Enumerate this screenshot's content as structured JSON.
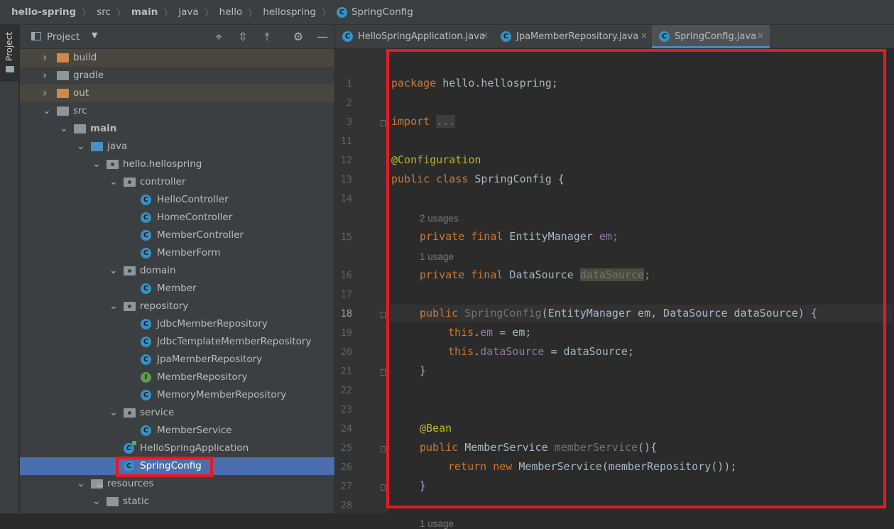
{
  "breadcrumb": [
    "hello-spring",
    "src",
    "main",
    "java",
    "hello",
    "hellospring",
    "SpringConfig"
  ],
  "tool_stripe": {
    "label": "Project"
  },
  "project_panel": {
    "title": "Project",
    "header_icons": [
      "locate-icon",
      "expand-all-icon",
      "collapse-all-icon",
      "gear-icon",
      "minimize-icon"
    ],
    "tree": [
      {
        "label": "build",
        "depth": 1,
        "icon": "folder-orange",
        "arrow": "right",
        "highlight": true
      },
      {
        "label": "gradle",
        "depth": 1,
        "icon": "folder",
        "arrow": "right"
      },
      {
        "label": "out",
        "depth": 1,
        "icon": "folder-orange",
        "arrow": "right",
        "highlight": true
      },
      {
        "label": "src",
        "depth": 1,
        "icon": "folder",
        "arrow": "down"
      },
      {
        "label": "main",
        "depth": 2,
        "icon": "folder-module",
        "arrow": "down",
        "bold": true
      },
      {
        "label": "java",
        "depth": 3,
        "icon": "folder-source",
        "arrow": "down"
      },
      {
        "label": "hello.hellospring",
        "depth": 4,
        "icon": "package",
        "arrow": "down"
      },
      {
        "label": "controller",
        "depth": 5,
        "icon": "package",
        "arrow": "down"
      },
      {
        "label": "HelloController",
        "depth": 6,
        "icon": "class"
      },
      {
        "label": "HomeController",
        "depth": 6,
        "icon": "class"
      },
      {
        "label": "MemberController",
        "depth": 6,
        "icon": "class"
      },
      {
        "label": "MemberForm",
        "depth": 6,
        "icon": "class"
      },
      {
        "label": "domain",
        "depth": 5,
        "icon": "package",
        "arrow": "down"
      },
      {
        "label": "Member",
        "depth": 6,
        "icon": "class"
      },
      {
        "label": "repository",
        "depth": 5,
        "icon": "package",
        "arrow": "down"
      },
      {
        "label": "JdbcMemberRepository",
        "depth": 6,
        "icon": "class"
      },
      {
        "label": "JdbcTemplateMemberRepository",
        "depth": 6,
        "icon": "class"
      },
      {
        "label": "JpaMemberRepository",
        "depth": 6,
        "icon": "class"
      },
      {
        "label": "MemberRepository",
        "depth": 6,
        "icon": "interface"
      },
      {
        "label": "MemoryMemberRepository",
        "depth": 6,
        "icon": "class"
      },
      {
        "label": "service",
        "depth": 5,
        "icon": "package",
        "arrow": "down"
      },
      {
        "label": "MemberService",
        "depth": 6,
        "icon": "class"
      },
      {
        "label": "HelloSpringApplication",
        "depth": 5,
        "icon": "class-run"
      },
      {
        "label": "SpringConfig",
        "depth": 5,
        "icon": "class",
        "selected": true
      },
      {
        "label": "resources",
        "depth": 3,
        "icon": "folder-resources",
        "arrow": "down"
      },
      {
        "label": "static",
        "depth": 4,
        "icon": "folder",
        "arrow": "down"
      }
    ]
  },
  "editor": {
    "tabs": [
      {
        "label": "HelloSpringApplication.java",
        "icon": "class-run",
        "active": false
      },
      {
        "label": "JpaMemberRepository.java",
        "icon": "class",
        "active": false
      },
      {
        "label": "SpringConfig.java",
        "icon": "class",
        "active": true
      }
    ],
    "close_glyph": "×",
    "line_numbers": [
      "1",
      "2",
      "3",
      "11",
      "12",
      "13",
      "14",
      "15",
      "16",
      "17",
      "18",
      "19",
      "20",
      "21",
      "22",
      "23",
      "24",
      "25",
      "26",
      "27",
      "28"
    ],
    "current_line": "18",
    "hints": {
      "h2": "2 usages",
      "h1": "1 usage",
      "h1b": "1 usage"
    },
    "code": {
      "l1_kw": "package",
      "l1_rest": " hello.hellospring;",
      "l3_kw": "import",
      "l3_fold": "...",
      "l12": "@Configuration",
      "l13_kw": "public class",
      "l13_rest": " SpringConfig {",
      "l15_kw": "private final",
      "l15_type": " EntityManager ",
      "l15_fld": "em",
      "l15_end": ";",
      "l16_kw": "private final",
      "l16_type": " DataSource ",
      "l16_fld": "dataSource",
      "l16_end": ";",
      "l18_kw": "public",
      "l18_name": " SpringConfig",
      "l18_rest": "(EntityManager em, DataSource dataSource) {",
      "l19_kw": "this",
      "l19_dot": ".",
      "l19_fld": "em",
      "l19_rest": " = em;",
      "l20_kw": "this",
      "l20_dot": ".",
      "l20_fld": "dataSource",
      "l20_rest": " = dataSource;",
      "l21": "}",
      "l24": "@Bean",
      "l25_kw": "public",
      "l25_type": " MemberService ",
      "l25_name": "memberService",
      "l25_rest": "(){",
      "l26_kw": "return new",
      "l26_rest": " MemberService(memberRepository());",
      "l27": "}"
    }
  },
  "colors": {
    "annotation_box": "#e51b24",
    "selection": "#4b6eaf",
    "keyword": "#cc7832",
    "field": "#9876aa"
  }
}
